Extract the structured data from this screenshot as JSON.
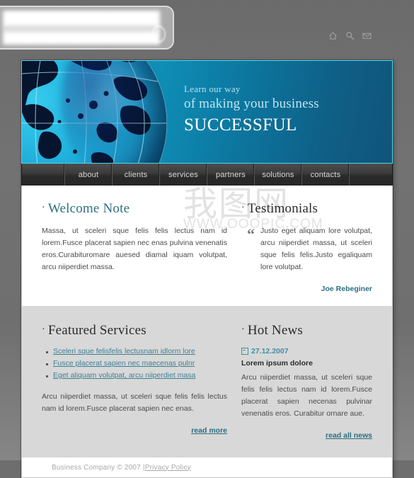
{
  "header": {
    "logo_alt": "company-logo-placeholder",
    "icons": [
      {
        "name": "home-icon",
        "label": "Home"
      },
      {
        "name": "search-icon",
        "label": "Search"
      },
      {
        "name": "mail-icon",
        "label": "Contact"
      }
    ]
  },
  "banner": {
    "line1": "Learn our way",
    "line2": "of making your business",
    "line3": "SUCCESSFUL",
    "image_alt": "globe-world-map"
  },
  "nav": {
    "items": [
      {
        "label": "about"
      },
      {
        "label": "clients"
      },
      {
        "label": "services"
      },
      {
        "label": "partners"
      },
      {
        "label": "solutions"
      },
      {
        "label": "contacts"
      }
    ]
  },
  "welcome": {
    "title": "Welcome Note",
    "body": "Massa, ut sceleri sque felis felis  lectus nam id lorem.Fusce placerat sapien nec enas pulvina venenatis eros.Curabituromare auesed diamal iquam volutpat, arcu niiperdiet massa."
  },
  "testimonials": {
    "title": "Testimonials",
    "quote": "Justo eget aliquam lore volutpat, arcu niiperdiet massa, ut sceleri sque felis felis.Justo egaliquam lore volutpat.",
    "author": "Joe Rebeginer"
  },
  "featured_services": {
    "title": "Featured Services",
    "links": [
      "Sceleri sque felisfelis lectusnam idlorm lore",
      "Fusce placerat sapien nec maecenas pulnr",
      "Eget aliquam volutpat, arcu niiperdiet masa"
    ],
    "body": "Arcu niiperdiet massa, ut sceleri sque felis felis lectus nam id lorem.Fusce placerat sapien nec enas.",
    "read_more": "read more"
  },
  "hot_news": {
    "title": "Hot News",
    "date": "27.12.2007",
    "headline": "Lorem ipsum dolore",
    "body": "Arcu niiperdiet massa, ut sceleri sque felis felis  lectus nam id lorem.Fusce placerat sapien necenas pulvinar venenatis eros. Curabitur ornare aue.",
    "read_all": "read all news"
  },
  "footer": {
    "copyright": "Business Company © 2007 | ",
    "privacy": "Privacy Policy"
  },
  "watermark": {
    "cjk": "我图网",
    "url": "WWW.OOOPIC.COM"
  },
  "colors": {
    "accent_teal": "#2e6f80",
    "link_blue": "#3d7f95",
    "banner_blue": "#0d7fa8",
    "nav_dark": "#3a3a3a",
    "page_bg": "#6e6e6e"
  }
}
